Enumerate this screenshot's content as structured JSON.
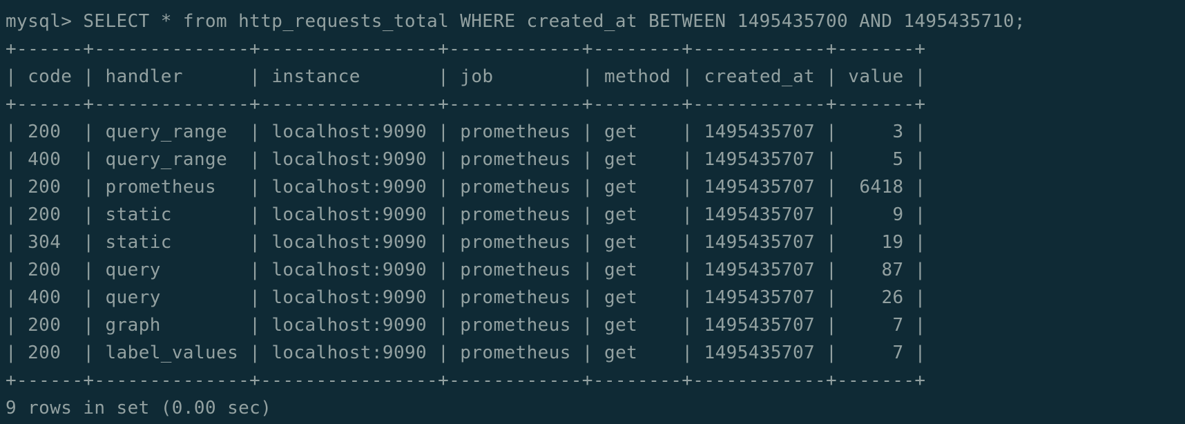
{
  "terminal": {
    "prompt": "mysql> ",
    "command": "SELECT * from http_requests_total WHERE created_at BETWEEN 1495435700 AND 1495435710;",
    "columns": [
      "code",
      "handler",
      "instance",
      "job",
      "method",
      "created_at",
      "value"
    ],
    "rows": [
      [
        "200",
        "query_range",
        "localhost:9090",
        "prometheus",
        "get",
        "1495435707",
        "3"
      ],
      [
        "400",
        "query_range",
        "localhost:9090",
        "prometheus",
        "get",
        "1495435707",
        "5"
      ],
      [
        "200",
        "prometheus",
        "localhost:9090",
        "prometheus",
        "get",
        "1495435707",
        "6418"
      ],
      [
        "200",
        "static",
        "localhost:9090",
        "prometheus",
        "get",
        "1495435707",
        "9"
      ],
      [
        "304",
        "static",
        "localhost:9090",
        "prometheus",
        "get",
        "1495435707",
        "19"
      ],
      [
        "200",
        "query",
        "localhost:9090",
        "prometheus",
        "get",
        "1495435707",
        "87"
      ],
      [
        "400",
        "query",
        "localhost:9090",
        "prometheus",
        "get",
        "1495435707",
        "26"
      ],
      [
        "200",
        "graph",
        "localhost:9090",
        "prometheus",
        "get",
        "1495435707",
        "7"
      ],
      [
        "200",
        "label_values",
        "localhost:9090",
        "prometheus",
        "get",
        "1495435707",
        "7"
      ]
    ],
    "summary": "9 rows in set (0.00 sec)"
  },
  "colors": {
    "background": "#0f2a35",
    "text": "#93a1a1"
  }
}
